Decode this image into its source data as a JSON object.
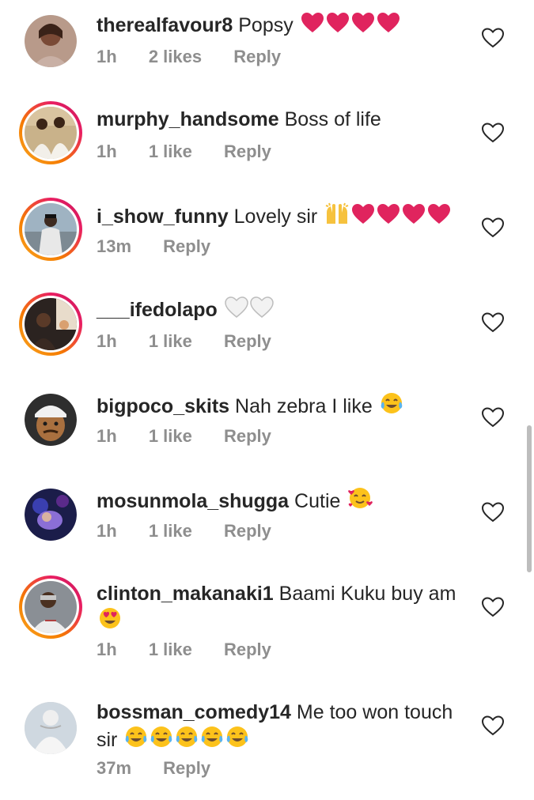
{
  "comments": [
    {
      "username": "therealfavour8",
      "text": "Popsy",
      "emojis": [
        "red-heart",
        "red-heart",
        "red-heart",
        "red-heart"
      ],
      "time": "1h",
      "likes": "2 likes",
      "reply": "Reply",
      "has_story_ring": false
    },
    {
      "username": "murphy_handsome",
      "text": "Boss of life",
      "emojis": [],
      "time": "1h",
      "likes": "1 like",
      "reply": "Reply",
      "has_story_ring": true
    },
    {
      "username": "i_show_funny",
      "text": "Lovely sir",
      "emojis": [
        "raising-hands",
        "red-heart",
        "red-heart",
        "red-heart",
        "red-heart"
      ],
      "time": "13m",
      "likes": "",
      "reply": "Reply",
      "has_story_ring": true
    },
    {
      "username": "___ifedolapo",
      "text": "",
      "emojis": [
        "white-heart",
        "white-heart"
      ],
      "time": "1h",
      "likes": "1 like",
      "reply": "Reply",
      "has_story_ring": true
    },
    {
      "username": "bigpoco_skits",
      "text": "Nah zebra I like",
      "emojis": [
        "tears-of-joy"
      ],
      "time": "1h",
      "likes": "1 like",
      "reply": "Reply",
      "has_story_ring": false
    },
    {
      "username": "mosunmola_shugga",
      "text": "Cutie",
      "emojis": [
        "smiling-face-with-hearts"
      ],
      "time": "1h",
      "likes": "1 like",
      "reply": "Reply",
      "has_story_ring": false
    },
    {
      "username": "clinton_makanaki1",
      "text": "Baami Kuku buy am",
      "emojis": [
        "heart-eyes"
      ],
      "time": "1h",
      "likes": "1 like",
      "reply": "Reply",
      "has_story_ring": true
    },
    {
      "username": "bossman_comedy14",
      "text": "Me too won touch sir",
      "emojis": [
        "tears-of-joy",
        "tears-of-joy",
        "tears-of-joy",
        "tears-of-joy",
        "tears-of-joy"
      ],
      "time": "37m",
      "likes": "",
      "reply": "Reply",
      "has_story_ring": false
    }
  ],
  "icons": {
    "like": "heart-outline-icon"
  },
  "colors": {
    "username": "#262626",
    "meta": "#8e8e8e",
    "heart_red": "#e0245e",
    "ring_start": "#f9a825",
    "ring_end": "#c2185b"
  }
}
